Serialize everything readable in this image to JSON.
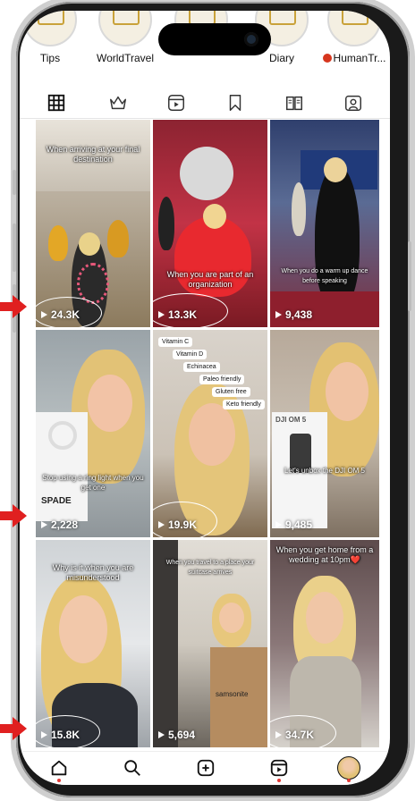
{
  "highlights": [
    {
      "label": "Tips"
    },
    {
      "label": "WorldTravel"
    },
    {
      "label": ""
    },
    {
      "label": "Diary"
    },
    {
      "label": "HumanTr..."
    }
  ],
  "tabs": [
    "grid-icon",
    "crown-icon",
    "reels-icon",
    "bookmark-icon",
    "guide-icon",
    "tagged-icon"
  ],
  "posts": [
    {
      "caption": "When arriving at your final destination",
      "views": "24.3K",
      "circled": true
    },
    {
      "caption": "When you are part of an organization",
      "views": "13.3K",
      "circled": true
    },
    {
      "caption": "When you do a warm up dance before speaking",
      "views": "9,438",
      "circled": false
    },
    {
      "caption": "Stop using a ring light when you get one",
      "views": "2,228",
      "circled": false
    },
    {
      "caption": "",
      "views": "19.9K",
      "circled": true,
      "tags": [
        "Vitamin C",
        "Vitamin D",
        "Echinacea",
        "Paleo friendly",
        "Gluten free",
        "Keto friendly"
      ]
    },
    {
      "caption": "Let's unbox the DJI OM 5",
      "views": "9,485",
      "circled": false
    },
    {
      "caption": "Why is it when you are misunderstood",
      "views": "15.8K",
      "circled": true
    },
    {
      "caption": "When you travel to a place your suitcase arrives",
      "views": "5,694",
      "circled": false
    },
    {
      "caption": "When you get home from a wedding at 10pm❤️",
      "views": "34.7K",
      "circled": true
    }
  ],
  "product_labels": {
    "spade": "SPADE",
    "dji": "DJI OM 5",
    "samsonite": "samsonite"
  },
  "nav": [
    "home-icon",
    "search-icon",
    "create-icon",
    "reels-icon",
    "profile-avatar"
  ],
  "colors": {
    "accent": "#e53935",
    "arrow": "#e02020"
  }
}
